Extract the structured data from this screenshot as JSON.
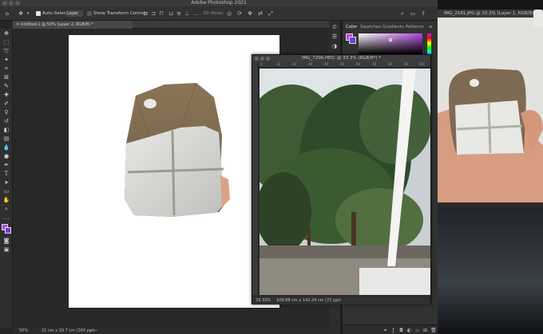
{
  "app": {
    "title": "Adobe Photoshop 2021"
  },
  "options_bar": {
    "auto_select_label": "Auto-Select:",
    "auto_select_checked": true,
    "layer_dropdown_value": "Layer",
    "show_transform_label": "Show Transform Controls",
    "show_transform_checked": false,
    "mode_label": "3D Mode:"
  },
  "document_tab": {
    "label": "Untitled-1 @ 50% (Layer 2, RGB/8) *"
  },
  "status_bar": {
    "zoom": "50%",
    "doc_info": "21 cm x 29.7 cm (300 ppi)"
  },
  "floating_window": {
    "title": "IMG_7206.HEIC @ 33.3% (RGB/8*) *",
    "zoom": "33.33%",
    "doc_info": "108.88 cm x 142.24 cm (72 ppi)",
    "ruler_labels": [
      "0",
      "10",
      "20",
      "30",
      "40",
      "50",
      "60",
      "70",
      "80",
      "90",
      "100"
    ]
  },
  "panels": {
    "tabs": [
      "Color",
      "Swatches",
      "Gradients",
      "Patterns"
    ],
    "active_tab": "Color",
    "foreground_color": "#c23fe0",
    "background_color": "#6a3ddb"
  },
  "second_window": {
    "title": "IMG_2181.JPG @ 33.3% (Layer 1, RGB/8)"
  },
  "colors": {
    "app_bg": "#262626",
    "panel_bg": "#323232",
    "canvas_white": "#ffffff",
    "accent_purple": "#b14be0"
  }
}
